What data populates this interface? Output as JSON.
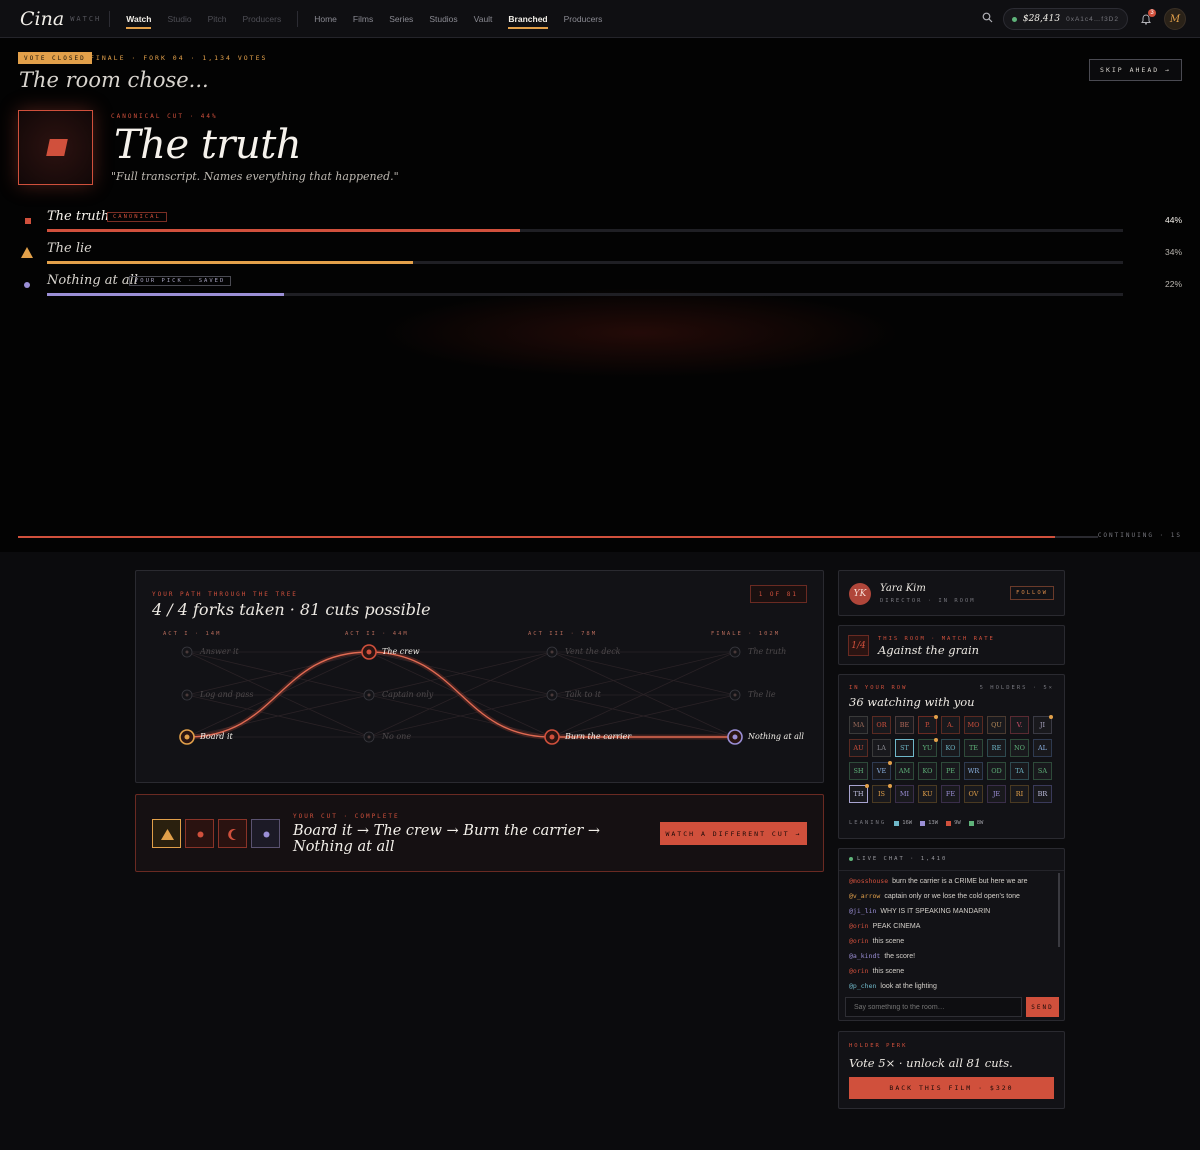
{
  "nav": {
    "logo": "Cina",
    "logo_sub": "WATCH",
    "mode_tabs": [
      "Watch",
      "Studio",
      "Pitch",
      "Producers"
    ],
    "links": [
      "Home",
      "Films",
      "Series",
      "Studios",
      "Vault",
      "Branched",
      "Producers"
    ],
    "active_mode": "Watch",
    "active_link": "Branched",
    "wallet_amount": "$28,413",
    "wallet_address": "0xA1c4…f3D2",
    "notif_count": "3",
    "avatar": "M"
  },
  "hero": {
    "vote_badge": "VOTE CLOSED",
    "vote_meta": "FINALE · FORK 04 · 1,134 VOTES",
    "heading": "The room chose...",
    "skip_label": "SKIP AHEAD →",
    "canonical_label": "CANONICAL CUT · 44%",
    "winner_title": "The truth",
    "winner_quote": "\"Full transcript. Names everything that happened.\"",
    "continuing": "CONTINUING · 1S",
    "continuing_progress": 0.96
  },
  "options": [
    {
      "name": "The truth",
      "tag": "CANONICAL",
      "pct_label": "44%",
      "pct": 44,
      "color": "#d0503c"
    },
    {
      "name": "The lie",
      "tag": "",
      "pct_label": "34%",
      "pct": 34,
      "color": "#e2a04a"
    },
    {
      "name": "Nothing at all",
      "tag": "YOUR PICK · SAVED",
      "pct_label": "22%",
      "pct": 22,
      "color": "#9b8fd6"
    }
  ],
  "tree": {
    "label": "YOUR PATH THROUGH THE TREE",
    "heading": "4 / 4 forks taken · 81 cuts possible",
    "counter": "1 OF 81",
    "acts": [
      "ACT I · 14M",
      "ACT II · 44M",
      "ACT III · 78M",
      "FINALE · 102M"
    ],
    "nodes": [
      [
        "Answer it",
        "Log and pass",
        "Board it"
      ],
      [
        "The crew",
        "Captain only",
        "No one"
      ],
      [
        "Vent the deck",
        "Talk to it",
        "Burn the carrier"
      ],
      [
        "The truth",
        "The lie",
        "Nothing at all"
      ]
    ],
    "chosen": [
      2,
      0,
      2,
      2
    ]
  },
  "your_cut": {
    "label": "YOUR CUT · COMPLETE",
    "path": "Board it → The crew → Burn the carrier → Nothing at all",
    "button": "WATCH A DIFFERENT CUT →"
  },
  "director": {
    "initials": "YK",
    "name": "Yara Kim",
    "role": "DIRECTOR · IN ROOM",
    "follow": "FOLLOW"
  },
  "match": {
    "ratio": "1/4",
    "label": "THIS ROOM · MATCH RATE",
    "value": "Against the grain"
  },
  "row": {
    "label": "IN YOUR ROW",
    "holders": "5 HOLDERS · 5×",
    "heading": "36 watching with you",
    "seats": [
      [
        "MA",
        "OR",
        "BE",
        "P.",
        "A.",
        "MO",
        "QU",
        "V.",
        "JI"
      ],
      [
        "AU",
        "LA",
        "ST",
        "YU",
        "KO",
        "TE",
        "RE",
        "NO",
        "AL"
      ],
      [
        "SH",
        "VE",
        "AM",
        "KO",
        "PE",
        "WR",
        "OD",
        "TA",
        "SA"
      ],
      [
        "TH",
        "IS",
        "MI",
        "KU",
        "FE",
        "OV",
        "JE",
        "RI",
        "BR"
      ]
    ],
    "leaning_label": "LEANING",
    "leaning": [
      {
        "value": "16w",
        "color": "#6fb8c9"
      },
      {
        "value": "13w",
        "color": "#9b8fd6"
      },
      {
        "value": "9w",
        "color": "#d0503c"
      },
      {
        "value": "8w",
        "color": "#5fb37a"
      }
    ]
  },
  "chat": {
    "label": "LIVE CHAT · 1,410",
    "messages": [
      {
        "user": "@mosshouse",
        "text": "burn the carrier is a CRIME but here we are",
        "color": "#d0503c"
      },
      {
        "user": "@v_arrow",
        "text": "captain only or we lose the cold open's tone",
        "color": "#e2a04a"
      },
      {
        "user": "@ji_lin",
        "text": "WHY IS IT SPEAKING MANDARIN",
        "color": "#9b8fd6"
      },
      {
        "user": "@orin",
        "text": "PEAK CINEMA",
        "color": "#d0503c"
      },
      {
        "user": "@orin",
        "text": "this scene",
        "color": "#d0503c"
      },
      {
        "user": "@a_kindt",
        "text": "the score!",
        "color": "#9b8fd6"
      },
      {
        "user": "@orin",
        "text": "this scene",
        "color": "#d0503c"
      },
      {
        "user": "@p_chen",
        "text": "look at the lighting",
        "color": "#6fb8c9"
      }
    ],
    "placeholder": "Say something to the room…",
    "send": "SEND"
  },
  "perk": {
    "label": "HOLDER PERK",
    "heading": "Vote 5× · unlock all 81 cuts.",
    "button": "BACK THIS FILM · $320"
  }
}
